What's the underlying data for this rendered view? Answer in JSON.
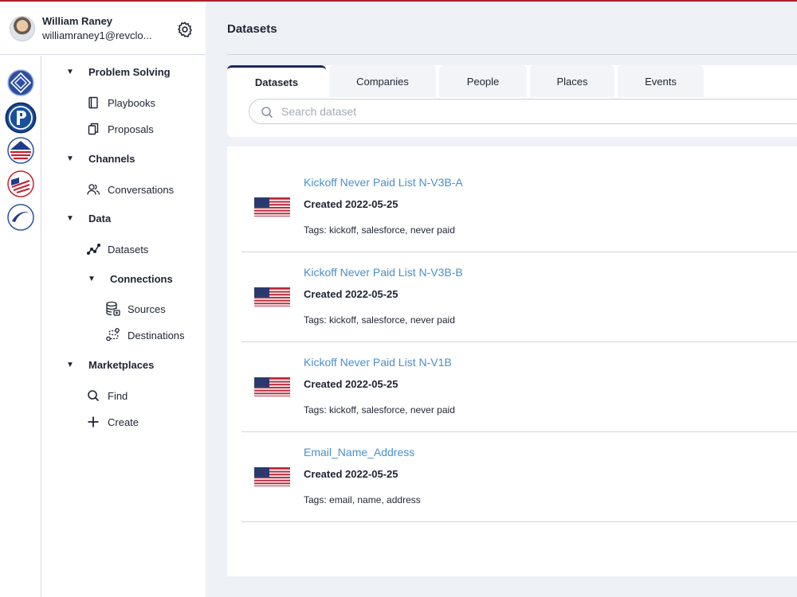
{
  "user": {
    "name": "William Raney",
    "email": "williamraney1@revclo..."
  },
  "nav": {
    "problem_solving": "Problem Solving",
    "playbooks": "Playbooks",
    "proposals": "Proposals",
    "channels": "Channels",
    "conversations": "Conversations",
    "data": "Data",
    "datasets": "Datasets",
    "connections": "Connections",
    "sources": "Sources",
    "destinations": "Destinations",
    "marketplaces": "Marketplaces",
    "find": "Find",
    "create": "Create"
  },
  "main": {
    "title": "Datasets",
    "tabs": [
      {
        "label": "Datasets"
      },
      {
        "label": "Companies"
      },
      {
        "label": "People"
      },
      {
        "label": "Places"
      },
      {
        "label": "Events"
      }
    ],
    "search_placeholder": "Search dataset"
  },
  "datasets": [
    {
      "title": "Kickoff Never Paid List N-V3B-A",
      "created": "Created 2022-05-25",
      "tags": "Tags: kickoff, salesforce, never paid"
    },
    {
      "title": "Kickoff Never Paid List N-V3B-B",
      "created": "Created 2022-05-25",
      "tags": "Tags: kickoff, salesforce, never paid"
    },
    {
      "title": "Kickoff Never Paid List N-V1B",
      "created": "Created 2022-05-25",
      "tags": "Tags: kickoff, salesforce, never paid"
    },
    {
      "title": "Email_Name_Address",
      "created": "Created 2022-05-25",
      "tags": "Tags: email, name, address"
    }
  ],
  "colors": {
    "accent": "#1a2a5e",
    "link": "#4a8fcb",
    "top_bar": "#b0202e",
    "background": "#eef1f6"
  }
}
